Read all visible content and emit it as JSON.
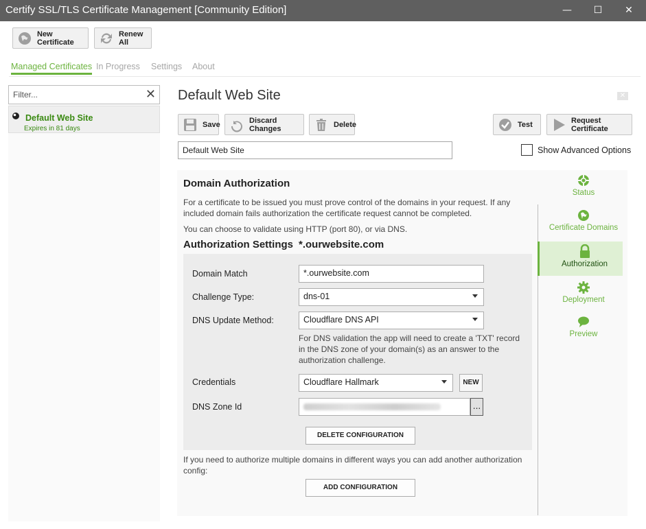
{
  "window": {
    "title": "Certify SSL/TLS Certificate Management [Community Edition]",
    "min": "—",
    "max": "☐",
    "close": "✕"
  },
  "toolbar": {
    "new_certificate": "New Certificate",
    "renew_all": "Renew All"
  },
  "tabs": [
    "Managed Certificates",
    "In Progress",
    "Settings",
    "About"
  ],
  "sidebar": {
    "filter_placeholder": "Filter...",
    "clear": "✕",
    "items": [
      {
        "name": "Default Web Site",
        "expires": "Expires in 81 days"
      }
    ]
  },
  "main": {
    "title": "Default Web Site",
    "close": "✕",
    "actions": {
      "save": "Save",
      "discard": "Discard Changes",
      "delete": "Delete",
      "test": "Test",
      "request": "Request Certificate"
    },
    "name_value": "Default Web Site",
    "show_advanced": "Show Advanced Options",
    "domain_auth": {
      "heading": "Domain Authorization",
      "intro": "For a certificate to be issued you must prove control of the domains in your request. If any included domain fails authorization the certificate request cannot be completed.",
      "validate_note": "You can choose to validate using HTTP (port 80), or via DNS.",
      "settings_heading": "Authorization Settings",
      "settings_domain": "*.ourwebsite.com",
      "fields": {
        "domain_match_label": "Domain Match",
        "domain_match_value": "*.ourwebsite.com",
        "challenge_type_label": "Challenge Type:",
        "challenge_type_value": "dns-01",
        "dns_method_label": "DNS Update Method:",
        "dns_method_value": "Cloudflare DNS API",
        "dns_help": "For DNS validation the app will need to create a 'TXT' record in the DNS zone of your domain(s) as an answer to the authorization challenge.",
        "credentials_label": "Credentials",
        "credentials_value": "Cloudflare Hallmark",
        "new_button": "NEW",
        "zone_label": "DNS Zone Id",
        "zone_button": "..."
      },
      "delete_config": "DELETE CONFIGURATION",
      "multi_note": "If you need to authorize multiple domains in different ways you can add another authorization config:",
      "add_config": "ADD CONFIGURATION"
    }
  },
  "right_nav": [
    {
      "label": "Status",
      "icon": "lifebuoy-icon"
    },
    {
      "label": "Certificate Domains",
      "icon": "globe-icon"
    },
    {
      "label": "Authorization",
      "icon": "lock-icon",
      "active": true
    },
    {
      "label": "Deployment",
      "icon": "gear-icon"
    },
    {
      "label": "Preview",
      "icon": "speech-bubble-icon"
    }
  ],
  "colors": {
    "accent": "#6cb33f",
    "titlebar": "#5f5f5f",
    "active_nav_bg": "#dff0d4"
  }
}
